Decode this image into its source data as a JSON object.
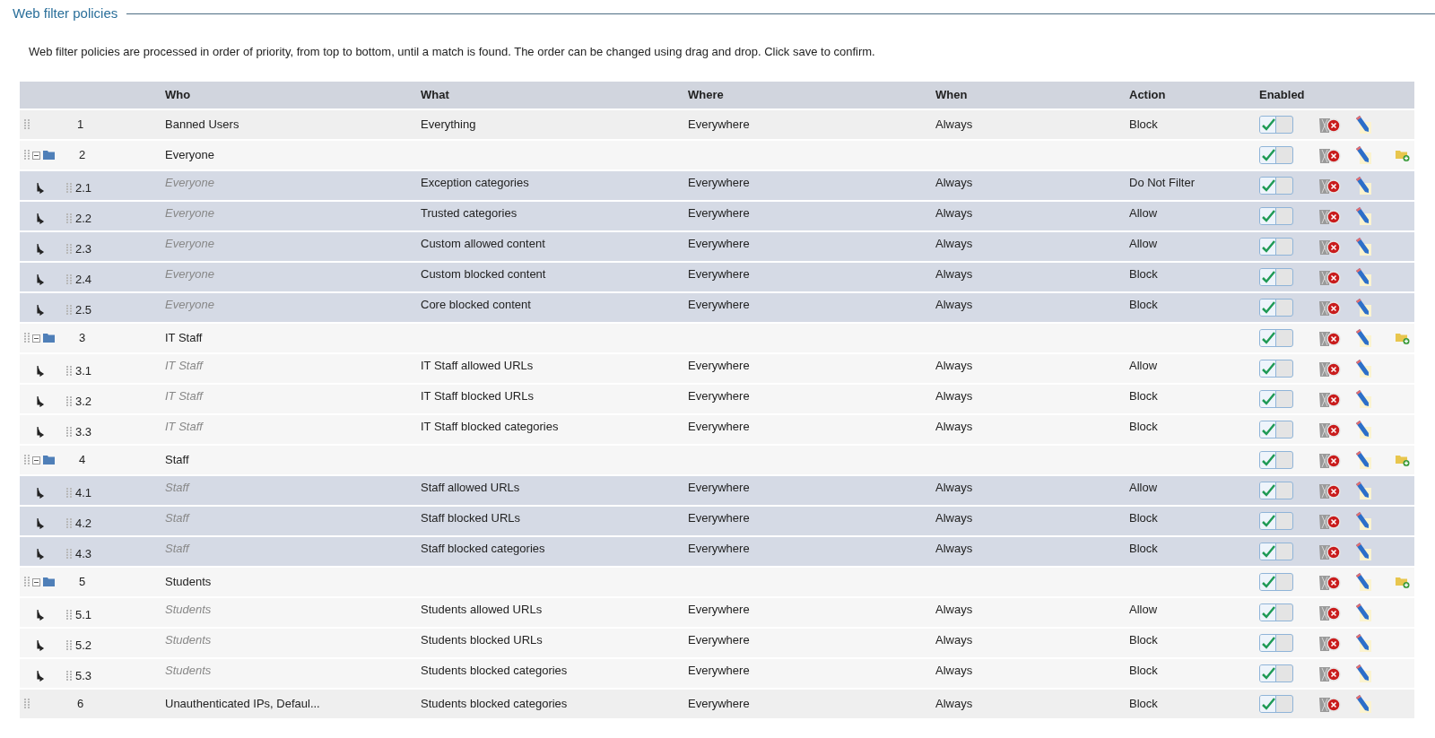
{
  "title": "Web filter policies",
  "description": "Web filter policies are processed in order of priority, from top to bottom, until a match is found. The order can be changed using drag and drop. Click save to confirm.",
  "columns": [
    "Who",
    "What",
    "Where",
    "When",
    "Action",
    "Enabled"
  ],
  "rows": [
    {
      "kind": "policy",
      "number": "1",
      "who": "Banned Users",
      "what": "Everything",
      "where": "Everywhere",
      "when": "Always",
      "action": "Block",
      "enabled": true
    },
    {
      "kind": "group",
      "number": "2",
      "who": "Everyone",
      "enabled": true,
      "expanded": true,
      "children": [
        {
          "number": "2.1",
          "who": "Everyone",
          "what": "Exception categories",
          "where": "Everywhere",
          "when": "Always",
          "action": "Do Not Filter",
          "enabled": true
        },
        {
          "number": "2.2",
          "who": "Everyone",
          "what": "Trusted categories",
          "where": "Everywhere",
          "when": "Always",
          "action": "Allow",
          "enabled": true
        },
        {
          "number": "2.3",
          "who": "Everyone",
          "what": "Custom allowed content",
          "where": "Everywhere",
          "when": "Always",
          "action": "Allow",
          "enabled": true
        },
        {
          "number": "2.4",
          "who": "Everyone",
          "what": "Custom blocked content",
          "where": "Everywhere",
          "when": "Always",
          "action": "Block",
          "enabled": true
        },
        {
          "number": "2.5",
          "who": "Everyone",
          "what": "Core blocked content",
          "where": "Everywhere",
          "when": "Always",
          "action": "Block",
          "enabled": true
        }
      ]
    },
    {
      "kind": "group",
      "number": "3",
      "who": "IT Staff",
      "enabled": true,
      "expanded": true,
      "children": [
        {
          "number": "3.1",
          "who": "IT Staff",
          "what": "IT Staff allowed URLs",
          "where": "Everywhere",
          "when": "Always",
          "action": "Allow",
          "enabled": true
        },
        {
          "number": "3.2",
          "who": "IT Staff",
          "what": "IT Staff blocked URLs",
          "where": "Everywhere",
          "when": "Always",
          "action": "Block",
          "enabled": true
        },
        {
          "number": "3.3",
          "who": "IT Staff",
          "what": "IT Staff blocked categories",
          "where": "Everywhere",
          "when": "Always",
          "action": "Block",
          "enabled": true
        }
      ]
    },
    {
      "kind": "group",
      "number": "4",
      "who": "Staff",
      "enabled": true,
      "expanded": true,
      "children": [
        {
          "number": "4.1",
          "who": "Staff",
          "what": "Staff allowed URLs",
          "where": "Everywhere",
          "when": "Always",
          "action": "Allow",
          "enabled": true
        },
        {
          "number": "4.2",
          "who": "Staff",
          "what": "Staff blocked URLs",
          "where": "Everywhere",
          "when": "Always",
          "action": "Block",
          "enabled": true
        },
        {
          "number": "4.3",
          "who": "Staff",
          "what": "Staff blocked categories",
          "where": "Everywhere",
          "when": "Always",
          "action": "Block",
          "enabled": true
        }
      ]
    },
    {
      "kind": "group",
      "number": "5",
      "who": "Students",
      "enabled": true,
      "expanded": true,
      "children": [
        {
          "number": "5.1",
          "who": "Students",
          "what": "Students allowed URLs",
          "where": "Everywhere",
          "when": "Always",
          "action": "Allow",
          "enabled": true
        },
        {
          "number": "5.2",
          "who": "Students",
          "what": "Students blocked URLs",
          "where": "Everywhere",
          "when": "Always",
          "action": "Block",
          "enabled": true
        },
        {
          "number": "5.3",
          "who": "Students",
          "what": "Students blocked categories",
          "where": "Everywhere",
          "when": "Always",
          "action": "Block",
          "enabled": true
        }
      ]
    },
    {
      "kind": "policy",
      "number": "6",
      "who": "Unauthenticated IPs, Defaul...",
      "what": "Students blocked categories",
      "where": "Everywhere",
      "when": "Always",
      "action": "Block",
      "enabled": true
    }
  ]
}
